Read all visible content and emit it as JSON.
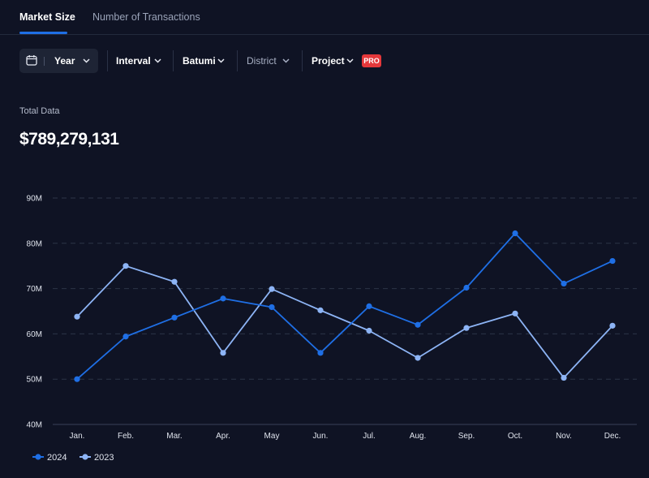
{
  "tabs": [
    {
      "label": "Market Size",
      "active": true
    },
    {
      "label": "Number of Transactions",
      "active": false
    }
  ],
  "filters": {
    "year": "Year",
    "interval": "Interval",
    "city": "Batumi",
    "district": "District",
    "project": "Project",
    "pro_badge": "PRO"
  },
  "summary": {
    "label": "Total Data",
    "value": "$789,279,131"
  },
  "colors": {
    "series_2024": "#1f6fe5",
    "series_2023": "#8db4f5",
    "background": "#0f1324",
    "accent": "#1f6fe5",
    "pro": "#e5383b"
  },
  "chart_data": {
    "type": "line",
    "categories": [
      "Jan.",
      "Feb.",
      "Mar.",
      "Apr.",
      "May",
      "Jun.",
      "Jul.",
      "Aug.",
      "Sep.",
      "Oct.",
      "Nov.",
      "Dec."
    ],
    "series": [
      {
        "name": "2024",
        "values": [
          50,
          59.4,
          63.6,
          67.8,
          65.9,
          55.8,
          66.1,
          62,
          70.2,
          82.2,
          71.1,
          76.1
        ]
      },
      {
        "name": "2023",
        "values": [
          63.8,
          75,
          71.5,
          55.8,
          69.9,
          65.2,
          60.7,
          54.7,
          61.3,
          64.5,
          50.3,
          61.8
        ]
      }
    ],
    "yticks": [
      "40M",
      "50M",
      "60M",
      "70M",
      "80M",
      "90M"
    ],
    "ylim": [
      40,
      90
    ],
    "grid": true,
    "legend_position": "bottom-left"
  }
}
